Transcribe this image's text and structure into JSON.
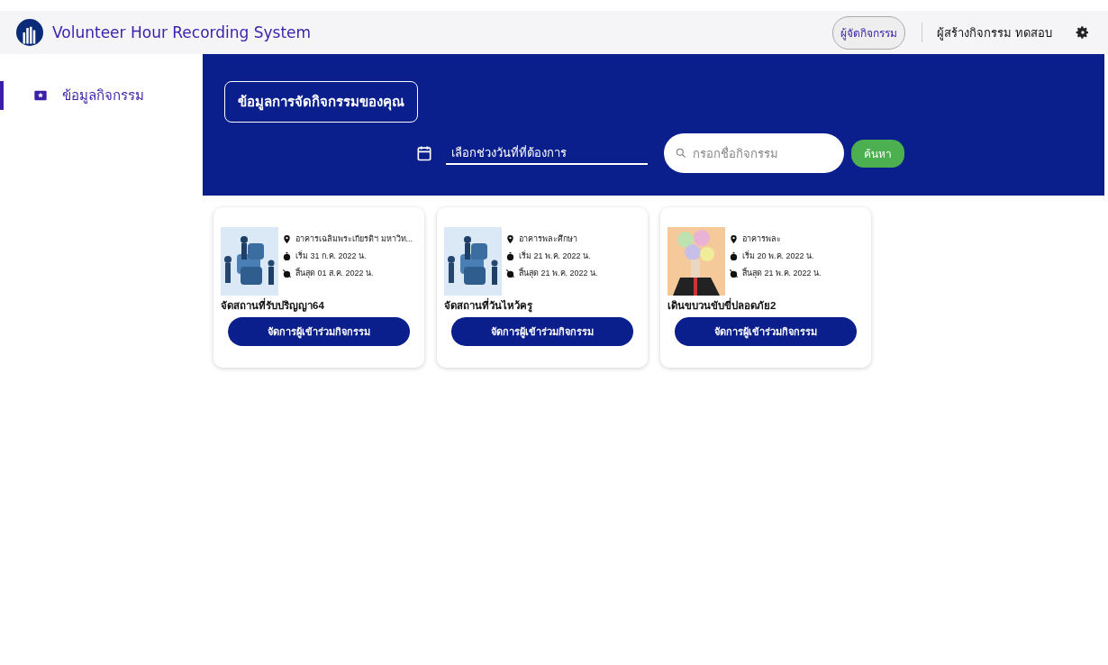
{
  "header": {
    "title": "Volunteer Hour Recording System",
    "role_button": "ผู้จัดกิจกรรม",
    "user_name": "ผู้สร้างกิจกรรม ทดสอบ"
  },
  "sidebar": {
    "items": [
      {
        "label": "ข้อมูลกิจกรรม",
        "selected": true
      }
    ]
  },
  "banner": {
    "heading": "ข้อมูลการจัดกิจกรรมของคุณ",
    "date_field": {
      "placeholder": "เลือกช่วงวันที่ที่ต้องการ"
    },
    "search_field": {
      "placeholder": "กรอกชื่อกิจกรรม"
    },
    "search_button": "ค้นหา"
  },
  "activities": [
    {
      "location": "อาคารเฉลิมพระเกียรติฯ มหาวิท...",
      "start": "เริ่ม 31 ก.ค. 2022 น.",
      "end": "สิ้นสุด 01 ส.ค. 2022 น.",
      "name": "จัดสถานที่รับปริญญา64",
      "button": "จัดการผู้เข้าร่วมกิจกรรม"
    },
    {
      "location": "อาคารพละศึกษา",
      "start": "เริ่ม 21 พ.ค. 2022 น.",
      "end": "สิ้นสุด 21 พ.ค. 2022 น.",
      "name": "จัดสถานที่วันไหว้ครู",
      "button": "จัดการผู้เข้าร่วมกิจกรรม"
    },
    {
      "location": "อาคารพละ",
      "start": "เริ่ม 20 พ.ค. 2022 น.",
      "end": "สิ้นสุด 21 พ.ค. 2022 น.",
      "name": "เดินขบวนขับขี่ปลอดภัย2",
      "button": "จัดการผู้เข้าร่วมกิจกรรม"
    }
  ]
}
